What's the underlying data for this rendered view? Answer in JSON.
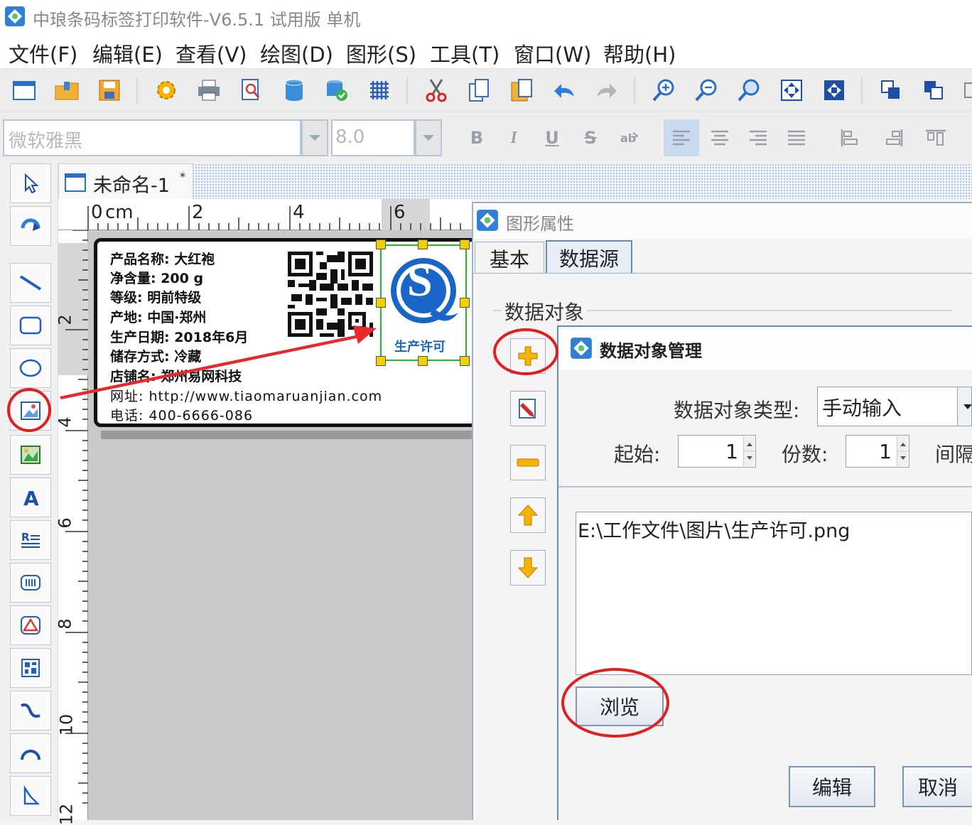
{
  "window": {
    "title": "中琅条码标签打印软件-V6.5.1 试用版 单机"
  },
  "menu": [
    "文件(F)",
    "编辑(E)",
    "查看(V)",
    "绘图(D)",
    "图形(S)",
    "工具(T)",
    "窗口(W)",
    "帮助(H)"
  ],
  "format": {
    "font_name": "微软雅黑",
    "font_size": "8.0",
    "bold": "B",
    "italic": "I",
    "underline": "U",
    "strike": "S"
  },
  "document": {
    "tab_title": "未命名-1",
    "modified_mark": "*"
  },
  "ruler": {
    "unit": "cm",
    "h_ticks": [
      "0",
      "2",
      "4",
      "6"
    ],
    "v_ticks": [
      "2",
      "4",
      "6",
      "8",
      "10",
      "12"
    ]
  },
  "label": {
    "lines": [
      "产品名称:  大红袍",
      "净含量:  200 g",
      "等级:  明前特级",
      "产地:  中国·郑州",
      "生产日期:  2018年6月",
      "储存方式:  冷藏",
      "店铺名:  郑州易网科技",
      "网址:  http://www.tiaomaruanjian.com",
      "电话:  400-6666-086"
    ],
    "logo_letter": "S",
    "logo_caption": "生产许可"
  },
  "properties": {
    "title": "图形属性",
    "tabs": [
      "基本",
      "数据源"
    ],
    "group_label": "数据对象"
  },
  "data_object_manager": {
    "title": "数据对象管理",
    "type_label": "数据对象类型:",
    "type_value": "手动输入",
    "start_label": "起始:",
    "start_value": "1",
    "copies_label": "份数:",
    "copies_value": "1",
    "interval_label": "间隔",
    "content": "E:\\工作文件\\图片\\生产许可.png",
    "browse_button": "浏览",
    "edit_button": "编辑",
    "cancel_button": "取消"
  },
  "colors": {
    "accent": "#1a66c8",
    "highlight": "#e02020",
    "selection": "#22bb22",
    "handle": "#f0d000"
  }
}
